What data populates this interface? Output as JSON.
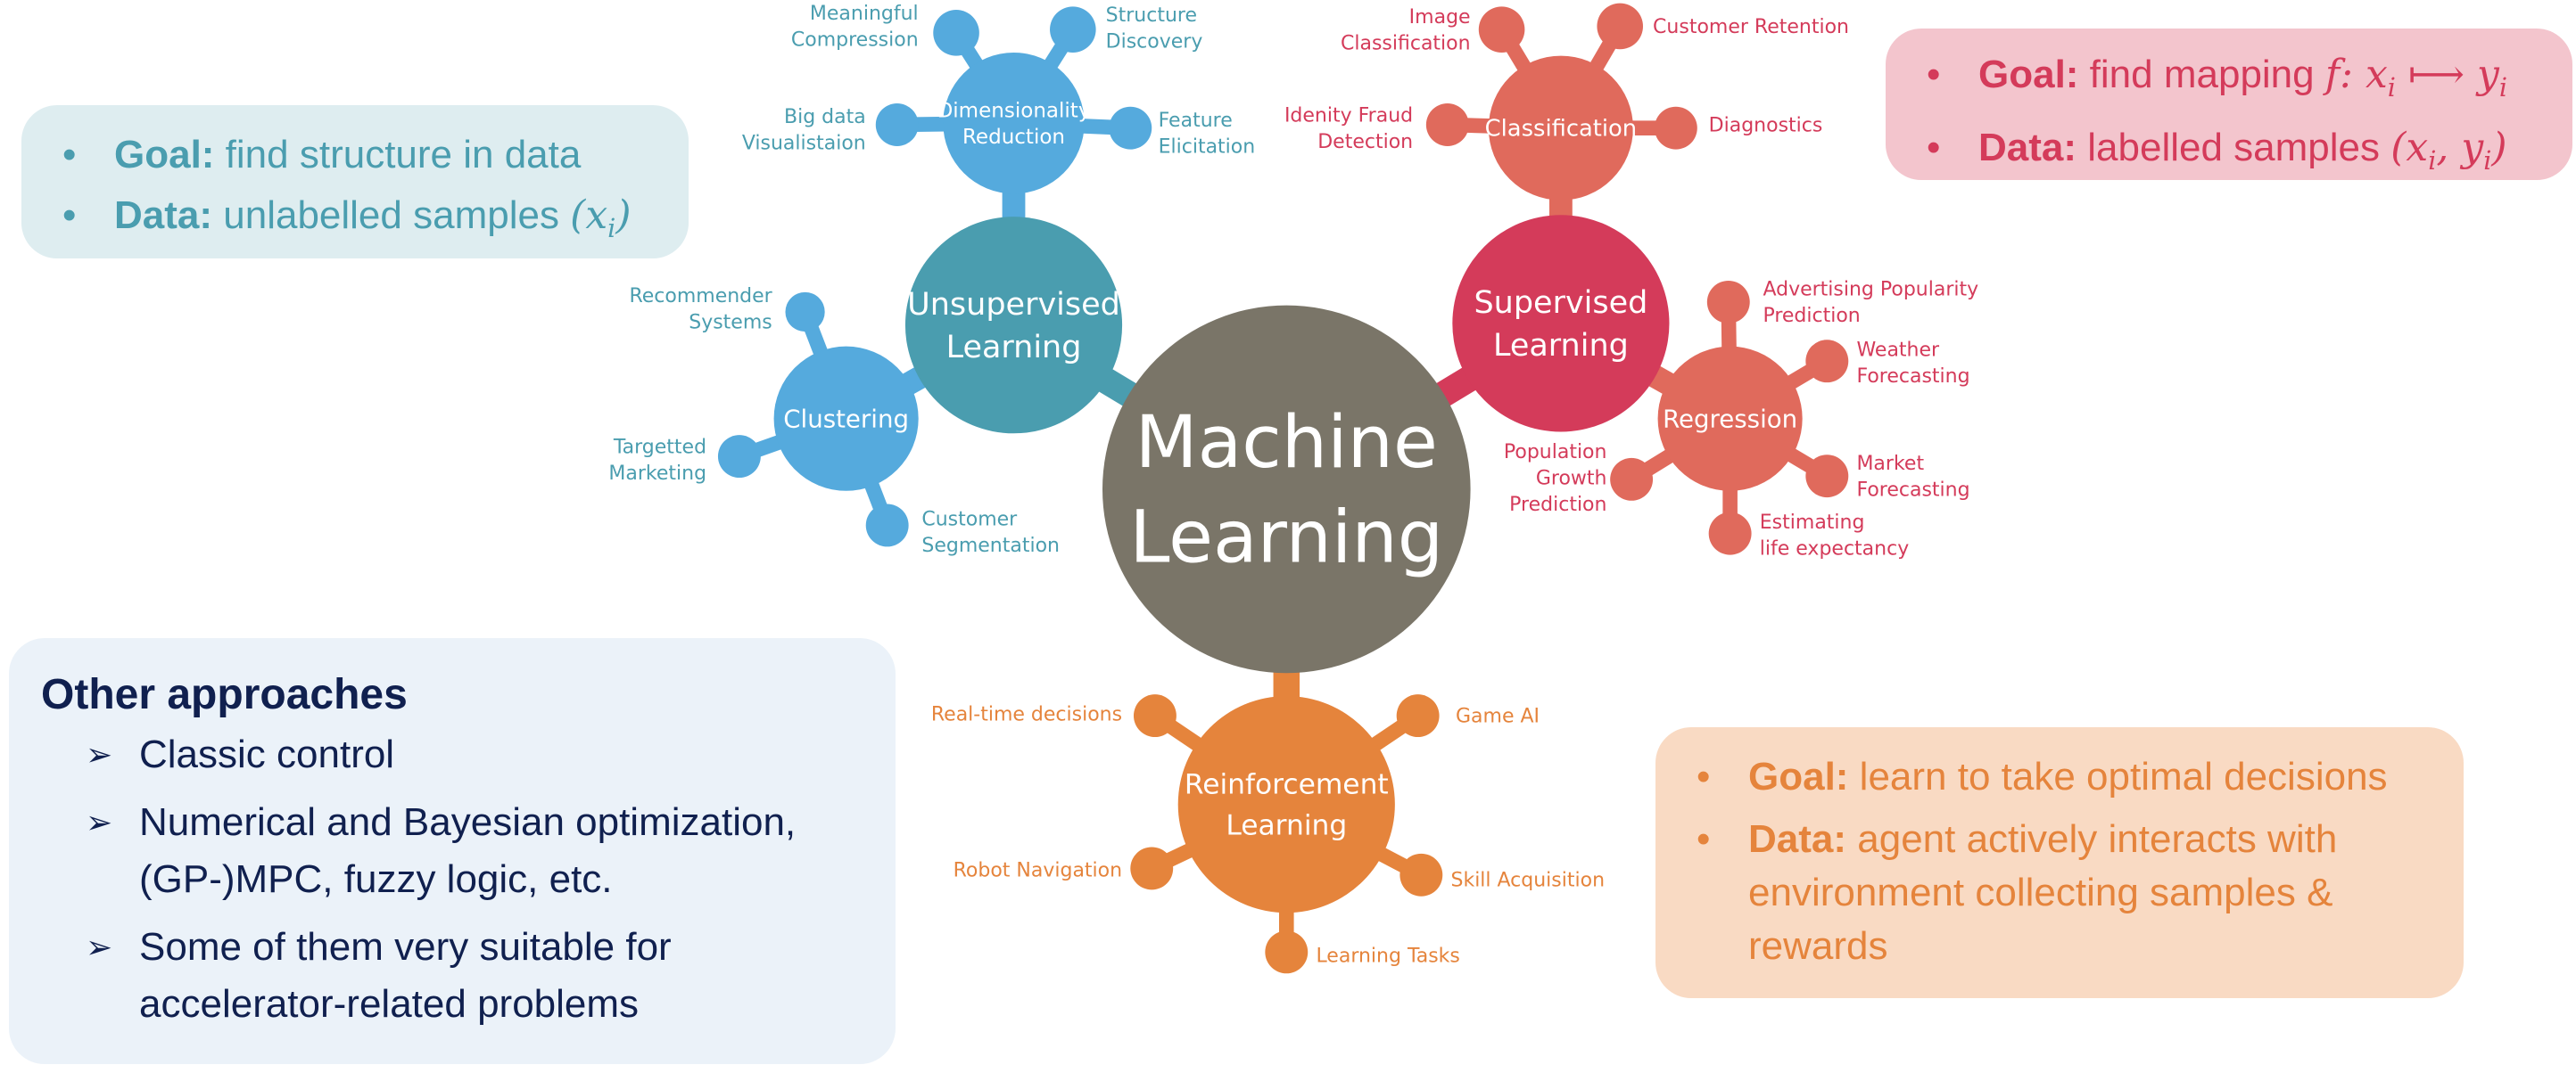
{
  "colors": {
    "center": "#7a7568",
    "unsupervised_main": "#4a9daf",
    "unsupervised_sub": "#55aadd",
    "unsupervised_text": "#4a9daf",
    "supervised_main": "#d43b5a",
    "supervised_sub": "#e06a5c",
    "supervised_text": "#d43b5a",
    "reinforcement_main": "#e5843c",
    "reinforcement_text": "#e5843c",
    "other_text": "#10204f"
  },
  "center": {
    "line1": "Machine",
    "line2": "Learning"
  },
  "unsupervised": {
    "line1": "Unsupervised",
    "line2": "Learning",
    "dimensionality": {
      "line1": "Dimensionality",
      "line2": "Reduction",
      "leaves": [
        {
          "l1": "Meaningful",
          "l2": "Compression"
        },
        {
          "l1": "Structure",
          "l2": "Discovery"
        },
        {
          "l1": "Big data",
          "l2": "Visualistaion"
        },
        {
          "l1": "Feature",
          "l2": "Elicitation"
        }
      ]
    },
    "clustering": {
      "label": "Clustering",
      "leaves": [
        {
          "l1": "Recommender",
          "l2": "Systems"
        },
        {
          "l1": "Targetted",
          "l2": "Marketing"
        },
        {
          "l1": "Customer",
          "l2": "Segmentation"
        }
      ]
    },
    "info": {
      "goal_label": "Goal:",
      "goal_text": " find structure in data",
      "data_label": "Data:",
      "data_text": " unlabelled samples ",
      "data_math": "(x",
      "data_math_sub": "i",
      "data_math_end": ")"
    }
  },
  "supervised": {
    "line1": "Supervised",
    "line2": "Learning",
    "classification": {
      "label": "Classification",
      "leaves": [
        {
          "l1": "Image",
          "l2": "Classification"
        },
        {
          "l1": "Customer Retention",
          "l2": ""
        },
        {
          "l1": "Idenity Fraud",
          "l2": "Detection"
        },
        {
          "l1": "Diagnostics",
          "l2": ""
        }
      ]
    },
    "regression": {
      "label": "Regression",
      "leaves": [
        {
          "l1": "Advertising Popularity",
          "l2": "Prediction"
        },
        {
          "l1": "Weather",
          "l2": "Forecasting"
        },
        {
          "l1": "Population",
          "l2": "Growth",
          "l3": "Prediction"
        },
        {
          "l1": "Market",
          "l2": "Forecasting"
        },
        {
          "l1": "Estimating",
          "l2": "life expectancy"
        }
      ]
    },
    "info": {
      "goal_label": "Goal:",
      "goal_text": " find mapping ",
      "goal_math": "f: x",
      "goal_math_sub": "i",
      "goal_math_arrow": " ⟼ y",
      "goal_math_sub2": "i",
      "data_label": "Data:",
      "data_text": " labelled samples ",
      "data_math": "(x",
      "data_math_sub": "i",
      "data_math_mid": ", y",
      "data_math_sub2": "i",
      "data_math_end": ")"
    }
  },
  "reinforcement": {
    "line1": "Reinforcement",
    "line2": "Learning",
    "leaves": [
      {
        "l1": "Real-time decisions"
      },
      {
        "l1": "Game AI"
      },
      {
        "l1": "Robot Navigation"
      },
      {
        "l1": "Skill Acquisition"
      },
      {
        "l1": "Learning Tasks"
      }
    ],
    "info": {
      "goal_label": "Goal:",
      "goal_text": " learn to take optimal decisions",
      "data_label": "Data:",
      "data_text": " agent actively interacts with environment collecting samples & rewards"
    }
  },
  "other": {
    "title": "Other approaches",
    "items": [
      "Classic control",
      "Numerical and Bayesian optimization, (GP-)MPC, fuzzy logic, etc.",
      "Some of them very suitable for accelerator-related problems"
    ]
  }
}
